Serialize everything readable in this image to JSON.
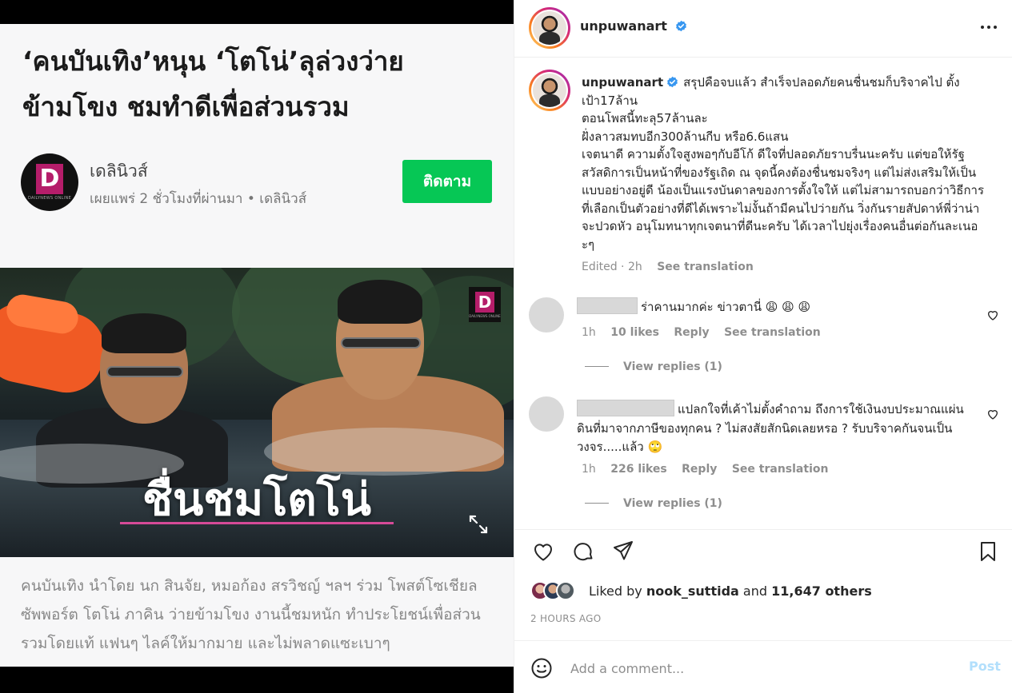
{
  "article": {
    "headline_line1": "‘คนบันเทิง’หนุน ‘โตโน่’ลุล่วงว่าย",
    "headline_line2": "ข้ามโขง ชมทำดีเพื่อส่วนรวม",
    "source_name": "เดลินิวส์",
    "source_meta": "เผยแพร่ 2 ชั่วโมงที่ผ่านมา • เดลินิวส์",
    "follow_label": "ติดตาม",
    "logo_letter": "D",
    "logo_tagline": "DAILYNEWS ONLINE",
    "hero_caption": "ชื่นชมโตโน่",
    "body": "คนบันเทิง นำโดย นก สินจัย, หมอก้อง สรวิชญ์ ฯลฯ ร่วม โพสต์โซเชียลซัพพอร์ต โตโน่ ภาคิน ว่ายข้ามโขง งานนี้ชมหนัก ทำประโยชน์เพื่อส่วนรวมโดยแท้ แฟนๆ ไลค์ให้มากมาย และไม่พลาดแซะเบาๆ"
  },
  "post": {
    "username": "unpuwanart",
    "caption": "สรุปคือจบแล้ว สำเร็จปลอดภัยคนชื่นชมก็บริจาคไป ตั้งเป้า17ล้าน\nตอนโพสนี้ทะลุ57ล้านละ\nฝั่งลาวสมทบอีก300ล้านกีบ หรือ6.6แสน\nเจตนาดี ความตั้งใจสูงพอๆกับอีโก้ ดีใจที่ปลอดภัยราบรื่นนะครับ แต่ขอให้รัฐสวัสดิการเป็นหน้าที่ของรัฐเถิด ณ จุดนี้คงต้องชื่นชมจริงๆ แต่ไม่ส่งเสริมให้เป็นแบบอย่างอยู่ดี น้องเป็นแรงบันดาลของการตั้งใจให้ แต่ไม่สามารถบอกว่าวิธีการที่เลือกเป็นตัวอย่างที่ดีได้เพราะไม่งั้นถ้ามีคนไปว่ายกัน วิ่งกันรายสัปดาห์พี่ว่าน่าจะปวดหัว อนุโมทนาทุกเจตนาที่ดีนะครับ ได้เวลาไปยุ่งเรื่องคนอื่นต่อกันละเนอะๆ",
    "edited": "Edited · 2h",
    "see_translation": "See translation"
  },
  "comments": [
    {
      "text": "ร่าคานมากค่ะ ข่าวตานี่ 😩 😩 😩",
      "time": "1h",
      "likes": "10 likes",
      "reply": "Reply",
      "see_translation": "See translation",
      "view_replies": "View replies (1)"
    },
    {
      "text": "แปลกใจที่เค้าไม่ตั้งคำถาม ถึงการใช้เงินงบประมาณแผ่นดินที่มาจากภาษีของทุกคน ? ไม่สงสัยสักนิดเลยหรอ ? รับบริจาคกันจนเป็นวงจร.....แล้ว 🙄",
      "time": "1h",
      "likes": "226 likes",
      "reply": "Reply",
      "see_translation": "See translation",
      "view_replies": "View replies (1)"
    }
  ],
  "likes": {
    "prefix": "Liked by",
    "user": "nook_suttida",
    "joiner": "and",
    "others": "11,647 others"
  },
  "timestamp": "2 HOURS AGO",
  "comment_box": {
    "placeholder": "Add a comment...",
    "post_label": "Post"
  },
  "icons": {
    "verified": "verified-badge-icon",
    "more": "more-options-icon",
    "heart": "heart-icon",
    "comment": "comment-icon",
    "share": "share-icon",
    "save": "bookmark-icon",
    "emoji": "emoji-icon",
    "expand": "expand-icon"
  },
  "colors": {
    "follow_green": "#06c755",
    "verified_blue": "#3897f0",
    "post_disabled": "#b2dffc",
    "brand_magenta": "#b51d6a"
  }
}
